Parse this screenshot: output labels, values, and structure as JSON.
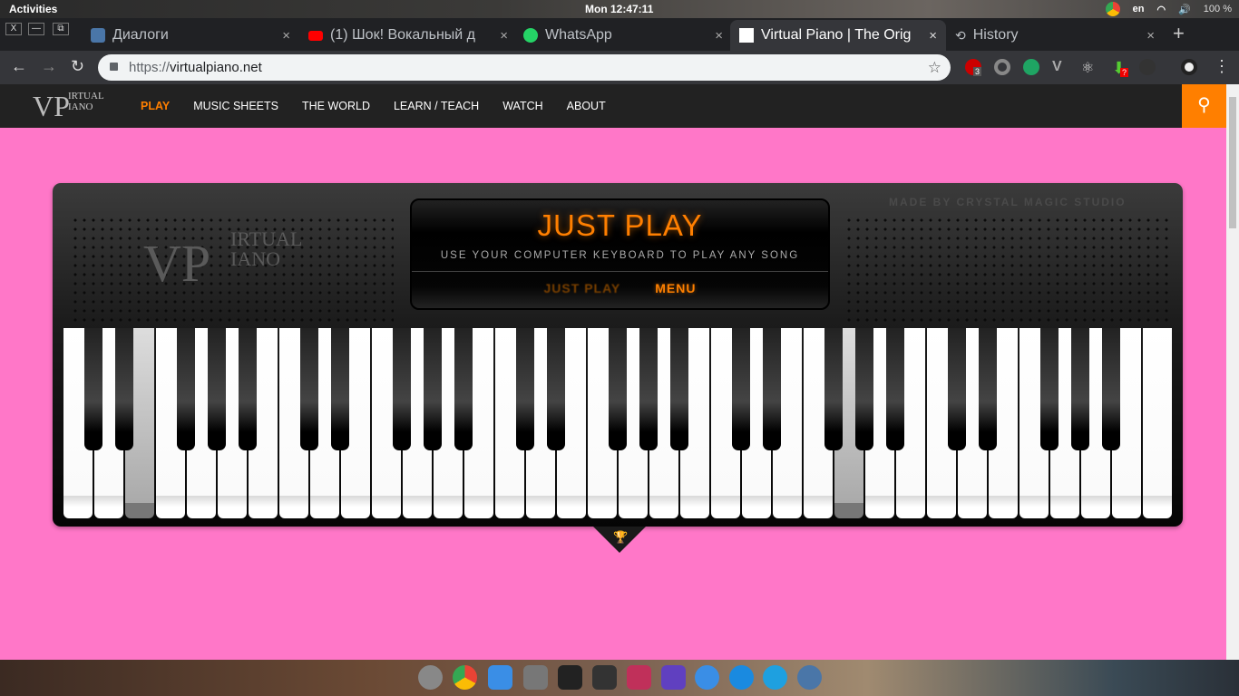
{
  "system": {
    "activities": "Activities",
    "clock": "Mon 12:47:11",
    "lang": "en",
    "battery": "100 %"
  },
  "tabs": [
    {
      "title": "Диалоги",
      "color": "#4a76a8"
    },
    {
      "title": "(1) Шок! Вокальный д",
      "color": "#ff0000"
    },
    {
      "title": "WhatsApp",
      "color": "#25d366"
    },
    {
      "title": "Virtual Piano | The Orig",
      "color": "#ffffff"
    },
    {
      "title": "History",
      "color": "#bdc1c6"
    }
  ],
  "window_controls": {
    "close": "X",
    "minimize": "—",
    "restore": "⧉"
  },
  "url": {
    "scheme": "https://",
    "host": "virtualpiano.net"
  },
  "extensions": {
    "abp_badge": "3",
    "download_badge": "?"
  },
  "site": {
    "logo_line1": "IRTUAL",
    "logo_line2": "IANO",
    "logo_mark": "VP",
    "nav": [
      "PLAY",
      "MUSIC SHEETS",
      "THE WORLD",
      "LEARN / TEACH",
      "WATCH",
      "ABOUT"
    ],
    "active_nav": "PLAY"
  },
  "piano": {
    "credit": "MADE BY CRYSTAL MAGIC STUDIO",
    "title": "JUST PLAY",
    "subtitle": "USE YOUR COMPUTER KEYBOARD TO PLAY ANY SONG",
    "mode_buttons": [
      "JUST PLAY",
      "MENU"
    ],
    "white_key_count": 36,
    "pressed_white_keys": [
      2,
      25
    ]
  },
  "colors": {
    "accent": "#ff7f00",
    "background": "#ff77c8"
  }
}
